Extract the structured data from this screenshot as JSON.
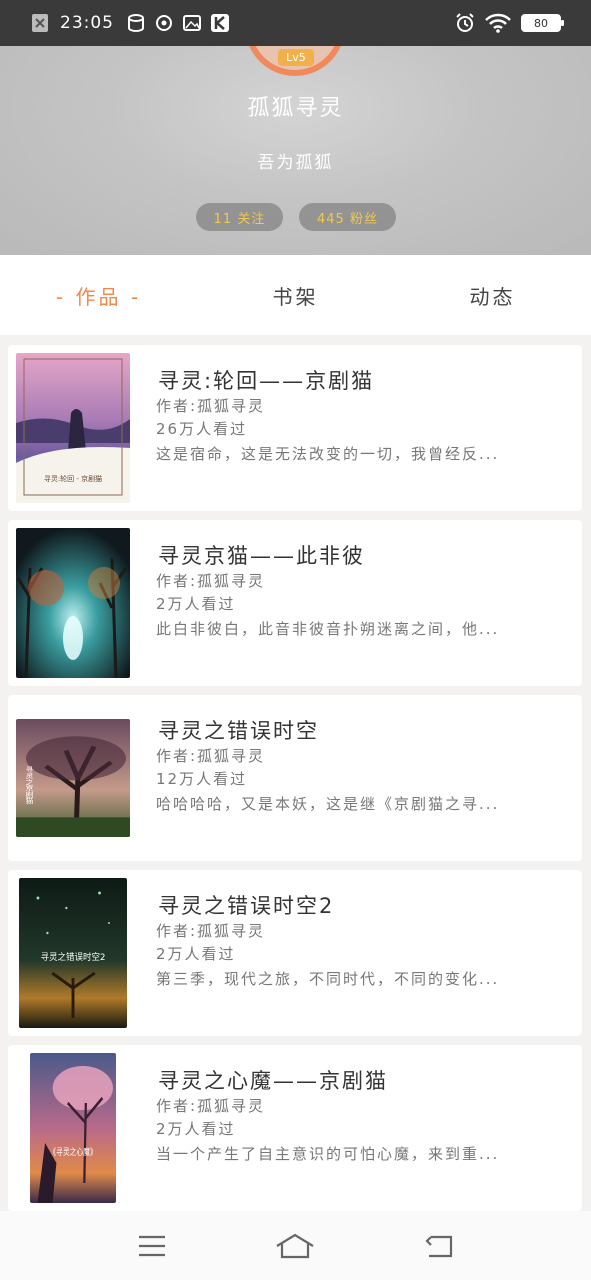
{
  "status_bar": {
    "time": "23:05",
    "battery": "80",
    "icons": [
      "close-notification-icon",
      "database-icon",
      "sync-icon",
      "image-icon",
      "k-app-icon",
      "alarm-icon",
      "wifi-icon",
      "battery-icon"
    ]
  },
  "profile": {
    "level": "Lv5",
    "username": "孤狐寻灵",
    "bio": "吾为孤狐",
    "follow": "11 关注",
    "fans": "445 粉丝"
  },
  "tabs": [
    {
      "label": "- 作品 -",
      "active": true
    },
    {
      "label": "书架",
      "active": false
    },
    {
      "label": "动态",
      "active": false
    }
  ],
  "books": [
    {
      "title": "寻灵:轮回——京剧猫",
      "author": "作者:孤狐寻灵",
      "views": "26万人看过",
      "desc": "这是宿命，这是无法改变的一切，我曾经反...",
      "cover_text": "寻灵:轮回 - 京剧猫"
    },
    {
      "title": "寻灵京猫——此非彼",
      "author": "作者:孤狐寻灵",
      "views": "2万人看过",
      "desc": "此白非彼白，此音非彼音扑朔迷离之间，他...",
      "cover_text": ""
    },
    {
      "title": "寻灵之错误时空",
      "author": "作者:孤狐寻灵",
      "views": "12万人看过",
      "desc": "哈哈哈哈，又是本妖，这是继《京剧猫之寻...",
      "cover_text": "寻灵之京剧猫"
    },
    {
      "title": "寻灵之错误时空2",
      "author": "作者:孤狐寻灵",
      "views": "2万人看过",
      "desc": "第三季，现代之旅，不同时代，不同的变化...",
      "cover_text": "寻灵之错误时空2"
    },
    {
      "title": "寻灵之心魔——京剧猫",
      "author": "作者:孤狐寻灵",
      "views": "2万人看过",
      "desc": "当一个产生了自主意识的可怕心魔，来到重...",
      "cover_text": "《寻灵之心魔》"
    }
  ],
  "colors": {
    "accent": "#f08a4b",
    "pill_text": "#f2c84b",
    "statusbar": "#3a3a3a"
  }
}
